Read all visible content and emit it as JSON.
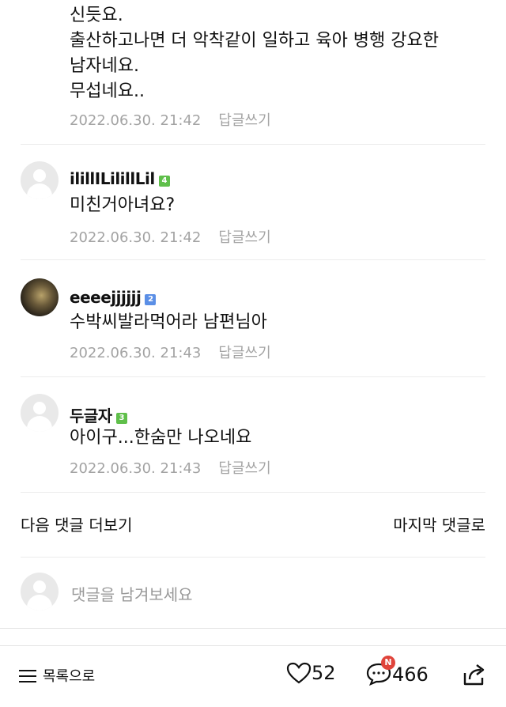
{
  "top_comment": {
    "lines": [
      "신듯요.",
      "출산하고나면 더 악착같이 일하고 육아 병행 강요한",
      "남자네요.",
      "무섭네요.."
    ],
    "date": "2022.06.30. 21:42",
    "reply_label": "답글쓰기"
  },
  "comments": [
    {
      "nickname": "ilillILilillLil",
      "level": "4",
      "text": "미친거아녀요?",
      "date": "2022.06.30. 21:42",
      "reply_label": "답글쓰기"
    },
    {
      "nickname": "eeeejjjjjj",
      "level": "2",
      "text": "수박씨발라먹어라 남편님아",
      "date": "2022.06.30. 21:43",
      "reply_label": "답글쓰기"
    },
    {
      "nickname": "두글자",
      "level": "3",
      "text": "아이구...한숨만 나오네요",
      "date": "2022.06.30. 21:43",
      "reply_label": "답글쓰기"
    }
  ],
  "pagination": {
    "next_label": "다음 댓글 더보기",
    "last_label": "마지막 댓글로"
  },
  "write": {
    "placeholder": "댓글을 남겨보세요"
  },
  "bottom_bar": {
    "list_label": "목록으로",
    "like_count": "52",
    "comment_count": "466",
    "new_badge": "N"
  },
  "colors": {
    "level_green": "#5fbf4a",
    "level_blue": "#5b8fe6",
    "badge_red": "#e0443b"
  }
}
